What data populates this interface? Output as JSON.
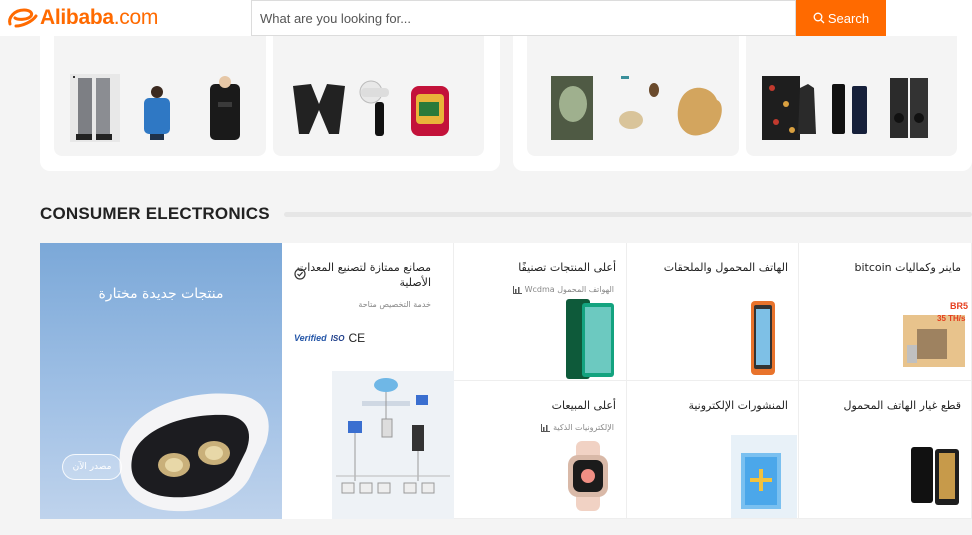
{
  "header": {
    "logo_text": "Alibaba",
    "logo_suffix": ".com",
    "search_placeholder": "What are you looking for...",
    "search_button_label": "Search",
    "brand_color": "#ff6a00"
  },
  "section": {
    "title": "CONSUMER ELECTRONICS"
  },
  "banner": {
    "title": "منتجات جديدة مختارة",
    "button_label": "مصدر الآن"
  },
  "factory": {
    "title": "مصانع ممتازة لتصنيع المعدات الأصلية",
    "subtitle": "خدمة التخصيص متاحة",
    "badge_verified": "Verified",
    "badge_iso": "ISO",
    "badge_ce": "CE"
  },
  "cells": [
    {
      "title": "أعلى المنتجات تصنيفًا",
      "subtitle": "الهواتف المحمول Wcdma"
    },
    {
      "title": "الهاتف المحمول والملحقات",
      "subtitle": ""
    },
    {
      "title": "ماينر وكماليات bitcoin",
      "subtitle": ""
    },
    {
      "title": "أعلى المبيعات",
      "subtitle": "الإلكترونيات الذكية"
    },
    {
      "title": "المنشورات الإلكترونية",
      "subtitle": ""
    },
    {
      "title": "قطع غيار الهاتف المحمول",
      "subtitle": ""
    }
  ],
  "miner_label": {
    "line1": "BR5",
    "line2": "35 TH/s"
  },
  "icons": {
    "search": "search-icon",
    "check": "check-badge-icon",
    "trend": "bar-chart-icon"
  }
}
